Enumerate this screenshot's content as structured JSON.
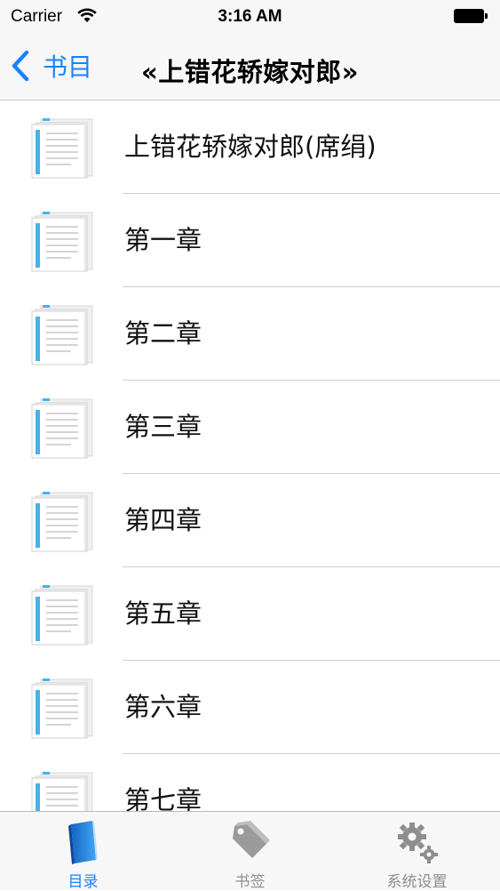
{
  "status_bar": {
    "carrier": "Carrier",
    "time": "3:16 AM"
  },
  "nav": {
    "back_label": "书目",
    "title": "«上错花轿嫁对郎»"
  },
  "colors": {
    "accent": "#1a82fb",
    "inactive": "#8e8e93",
    "doc_bar": "#47b3e8"
  },
  "list": {
    "items": [
      {
        "label": "上错花轿嫁对郎(席绢)",
        "icon": "document-icon"
      },
      {
        "label": "第一章",
        "icon": "document-icon"
      },
      {
        "label": "第二章",
        "icon": "document-icon"
      },
      {
        "label": "第三章",
        "icon": "document-icon"
      },
      {
        "label": "第四章",
        "icon": "document-icon"
      },
      {
        "label": "第五章",
        "icon": "document-icon"
      },
      {
        "label": "第六章",
        "icon": "document-icon"
      },
      {
        "label": "第七章",
        "icon": "document-icon"
      }
    ]
  },
  "tabs": [
    {
      "label": "目录",
      "icon": "book-icon",
      "active": true
    },
    {
      "label": "书签",
      "icon": "tag-icon",
      "active": false
    },
    {
      "label": "系统设置",
      "icon": "gears-icon",
      "active": false
    }
  ]
}
